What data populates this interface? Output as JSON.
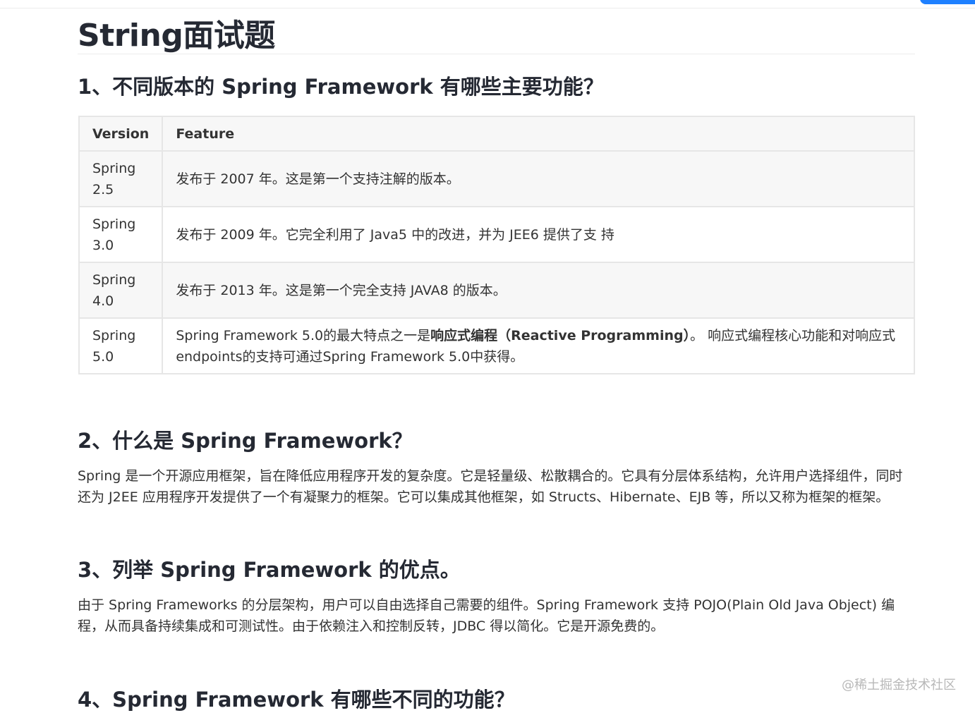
{
  "page_title": "String面试题",
  "sections": [
    {
      "heading": "1、不同版本的 Spring Framework 有哪些主要功能？",
      "table": {
        "headers": [
          "Version",
          "Feature"
        ],
        "rows": [
          {
            "version": "Spring 2.5",
            "feature": "发布于 2007 年。这是第一个支持注解的版本。"
          },
          {
            "version": "Spring 3.0",
            "feature": "发布于 2009 年。它完全利用了 Java5 中的改进，并为 JEE6 提供了支 持"
          },
          {
            "version": "Spring 4.0",
            "feature": "发布于 2013 年。这是第一个完全支持 JAVA8 的版本。"
          },
          {
            "version": "Spring 5.0",
            "feature_before": "Spring Framework 5.0的最大特点之一是",
            "feature_bold": "响应式编程（Reactive Programming）",
            "feature_after": "。 响应式编程核心功能和对响应式endpoints的支持可通过Spring Framework 5.0中获得。"
          }
        ]
      }
    },
    {
      "heading": "2、什么是 Spring Framework？",
      "text": "Spring 是一个开源应用框架，旨在降低应用程序开发的复杂度。它是轻量级、松散耦合的。它具有分层体系结构，允许用户选择组件，同时还为 J2EE 应用程序开发提供了一个有凝聚力的框架。它可以集成其他框架，如 Structs、Hibernate、EJB 等，所以又称为框架的框架。"
    },
    {
      "heading": "3、列举 Spring Framework 的优点。",
      "text": "由于 Spring Frameworks 的分层架构，用户可以自由选择自己需要的组件。Spring Framework 支持 POJO(Plain Old Java Object) 编程，从而具备持续集成和可测试性。由于依赖注入和控制反转，JDBC 得以简化。它是开源免费的。"
    },
    {
      "heading": "4、Spring Framework 有哪些不同的功能？"
    }
  ],
  "watermark": "@稀土掘金技术社区",
  "colors": {
    "accent": "#1e80ff",
    "heading": "#252933",
    "text": "#333333",
    "table_border": "#e6e6e6",
    "table_stripe": "#f7f7f7"
  }
}
